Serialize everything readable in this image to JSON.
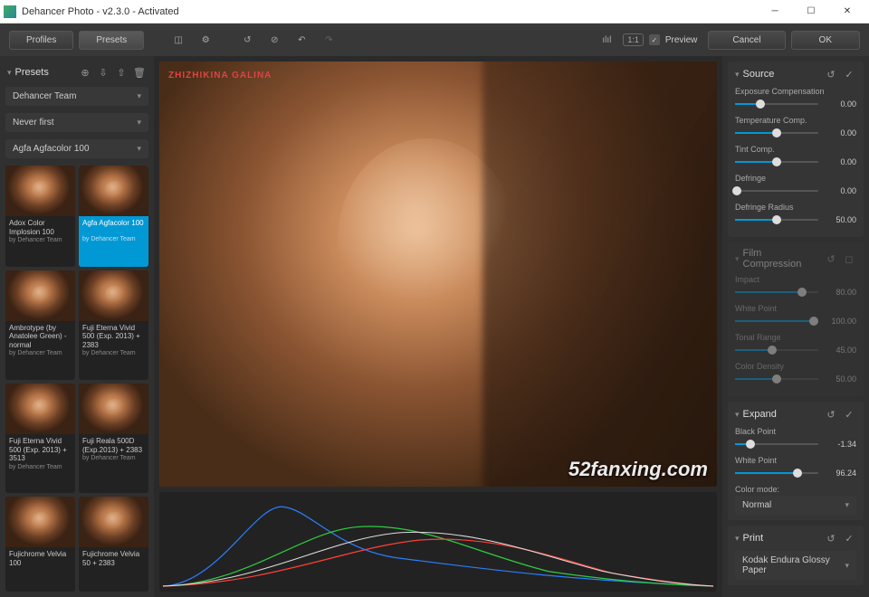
{
  "window": {
    "title": "Dehancer Photo - v2.3.0 - Activated"
  },
  "toolbar": {
    "profiles": "Profiles",
    "presets": "Presets",
    "preview_label": "Preview",
    "ratio": "1:1",
    "cancel": "Cancel",
    "ok": "OK"
  },
  "presets": {
    "title": "Presets",
    "dropdown1": "Dehancer Team",
    "dropdown2": "Never first",
    "dropdown3": "Agfa Agfacolor 100",
    "items": [
      {
        "name": "Adox Color Implosion 100",
        "author": "by Dehancer Team"
      },
      {
        "name": "Agfa Agfacolor 100",
        "author": "by Dehancer Team",
        "selected": true
      },
      {
        "name": "Ambrotype (by Anatolee Green) - normal",
        "author": "by Dehancer Team"
      },
      {
        "name": "Fuji Eterna Vivid 500 (Exp. 2013) + 2383",
        "author": "by Dehancer Team"
      },
      {
        "name": "Fuji Eterna Vivid 500 (Exp. 2013) + 3513",
        "author": "by Dehancer Team"
      },
      {
        "name": "Fuji Reala 500D (Exp.2013) + 2383",
        "author": "by Dehancer Team"
      },
      {
        "name": "Fujichrome Velvia 100",
        "author": ""
      },
      {
        "name": "Fujichrome Velvia 50 + 2383",
        "author": ""
      }
    ]
  },
  "viewer": {
    "watermark_tl": "ZHIZHIKINA GALINA",
    "watermark_br": "52fanxing.com"
  },
  "source": {
    "title": "Source",
    "exposure": {
      "label": "Exposure Compensation",
      "value": "0.00",
      "pos": 30
    },
    "temp": {
      "label": "Temperature Comp.",
      "value": "0.00",
      "pos": 50
    },
    "tint": {
      "label": "Tint Comp.",
      "value": "0.00",
      "pos": 50
    },
    "defringe": {
      "label": "Defringe",
      "value": "0.00",
      "pos": 2
    },
    "defringe_radius": {
      "label": "Defringe Radius",
      "value": "50.00",
      "pos": 50
    }
  },
  "film": {
    "title": "Film Compression",
    "impact": {
      "label": "Impact",
      "value": "80.00",
      "pos": 80
    },
    "white": {
      "label": "White Point",
      "value": "100.00",
      "pos": 95
    },
    "tonal": {
      "label": "Tonal Range",
      "value": "45.00",
      "pos": 45
    },
    "density": {
      "label": "Color Density",
      "value": "50.00",
      "pos": 50
    }
  },
  "expand": {
    "title": "Expand",
    "black": {
      "label": "Black Point",
      "value": "-1.34",
      "pos": 18
    },
    "white": {
      "label": "White Point",
      "value": "96.24",
      "pos": 75
    },
    "colormode_label": "Color mode:",
    "colormode_value": "Normal"
  },
  "print": {
    "title": "Print",
    "paper": "Kodak Endura Glossy Paper"
  }
}
